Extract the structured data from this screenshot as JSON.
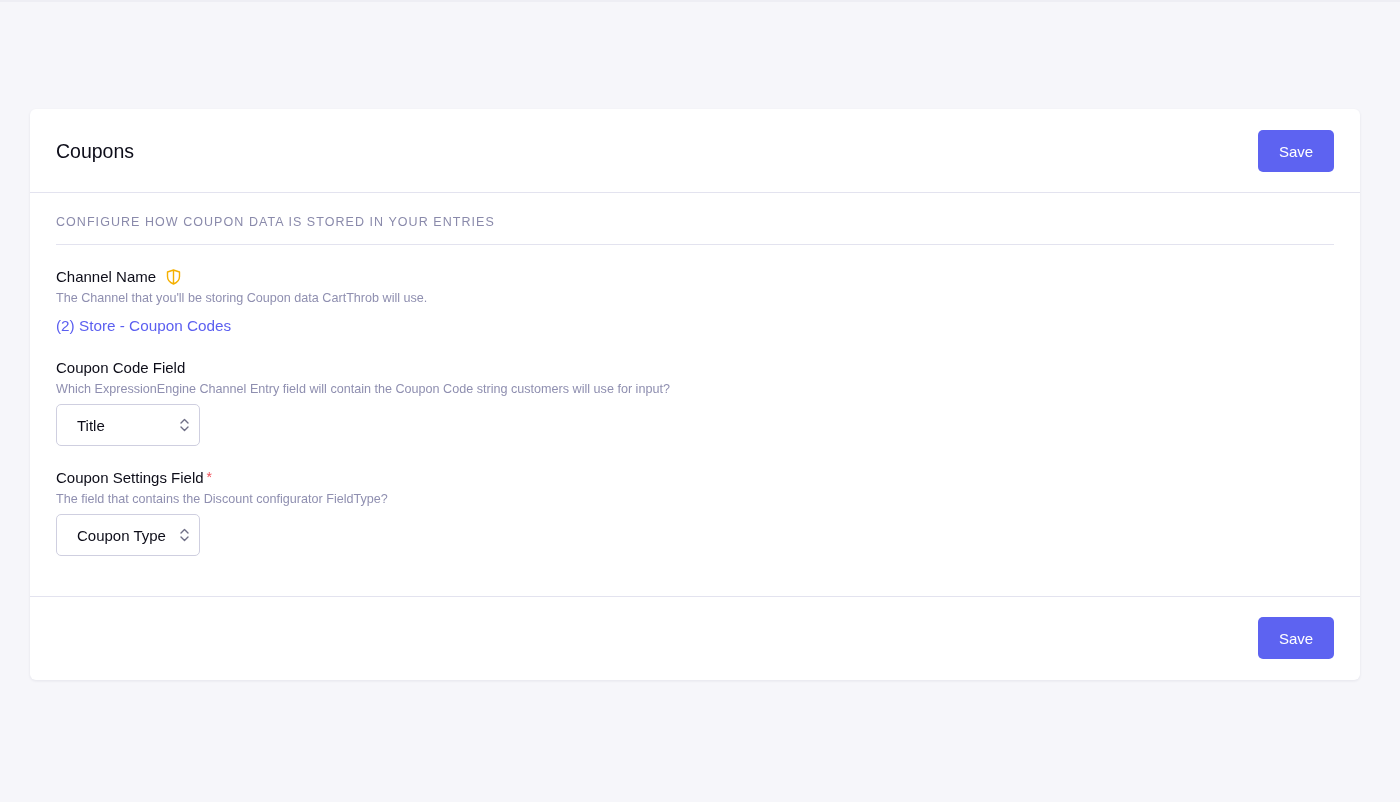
{
  "page": {
    "title": "Coupons"
  },
  "header_actions": [
    {
      "label": "Save"
    }
  ],
  "section": {
    "heading": "CONFIGURE HOW COUPON DATA IS STORED IN YOUR ENTRIES",
    "fields": [
      {
        "kind": "link",
        "label": "Channel Name",
        "shield": true,
        "description": "The Channel that you'll be storing Coupon data CartThrob will use.",
        "value": "(2) Store - Coupon Codes"
      },
      {
        "kind": "select",
        "label": "Coupon Code Field",
        "shield": false,
        "description": "Which ExpressionEngine Channel Entry field will contain the Coupon Code string customers will use for input?",
        "value": "Title"
      },
      {
        "kind": "select",
        "label": "Coupon Settings Field",
        "shield": false,
        "required_mark": "*",
        "description": "The field that contains the Discount configurator FieldType?",
        "value": "Coupon Type"
      }
    ]
  },
  "footer_actions": [
    {
      "label": "Save"
    }
  ]
}
